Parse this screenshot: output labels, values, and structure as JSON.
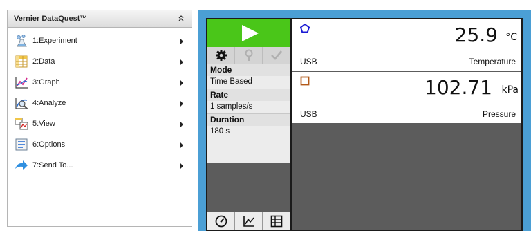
{
  "menu": {
    "title": "Vernier DataQuest™",
    "items": [
      {
        "label": "1:Experiment",
        "icon": "experiment-icon"
      },
      {
        "label": "2:Data",
        "icon": "data-table-icon"
      },
      {
        "label": "3:Graph",
        "icon": "graph-icon"
      },
      {
        "label": "4:Analyze",
        "icon": "analyze-icon"
      },
      {
        "label": "5:View",
        "icon": "view-icon"
      },
      {
        "label": "6:Options",
        "icon": "options-icon"
      },
      {
        "label": "7:Send To...",
        "icon": "send-to-icon"
      }
    ]
  },
  "controls": {
    "settings": [
      {
        "label": "Mode",
        "value": "Time Based"
      },
      {
        "label": "Rate",
        "value": "1 samples/s"
      },
      {
        "label": "Duration",
        "value": "180 s"
      }
    ]
  },
  "meters": [
    {
      "value": "25.9",
      "unit": "°C",
      "source": "USB",
      "sensor": "Temperature",
      "marker": "pentagon",
      "marker_color": "#1a1ad4"
    },
    {
      "value": "102.71",
      "unit": "kPa",
      "source": "USB",
      "sensor": "Pressure",
      "marker": "square",
      "marker_color": "#b35a1a"
    }
  ],
  "colors": {
    "collect": "#4ac619",
    "frame": "#4b9fd5",
    "panel_bg": "#5c5c5c"
  }
}
